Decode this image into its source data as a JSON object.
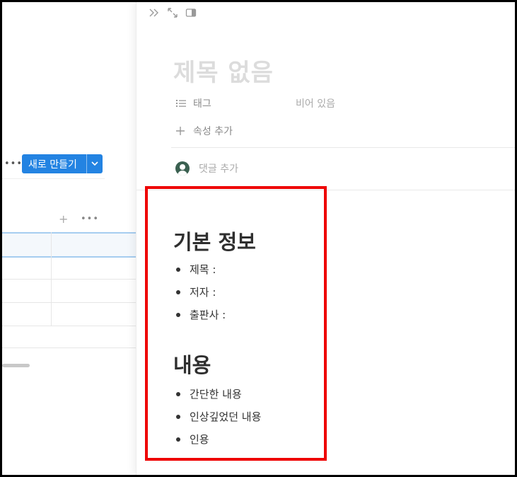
{
  "left_panel": {
    "more_label": "•••",
    "new_button_label": "새로 만들기",
    "column_add": "+",
    "column_more": "•••"
  },
  "peek": {
    "title": "제목 없음",
    "properties": [
      {
        "icon": "list-icon",
        "name": "태그",
        "value": "비어 있음"
      }
    ],
    "add_property_label": "속성 추가",
    "comment_placeholder": "댓글 추가"
  },
  "content": {
    "sections": [
      {
        "heading": "기본 정보",
        "items": [
          "제목 :",
          "저자 :",
          "출판사 :"
        ]
      },
      {
        "heading": "내용",
        "items": [
          "간단한 내용",
          "인상깊었던 내용",
          "인용"
        ]
      }
    ]
  },
  "colors": {
    "accent": "#2383e2",
    "highlight": "#ee0000"
  }
}
